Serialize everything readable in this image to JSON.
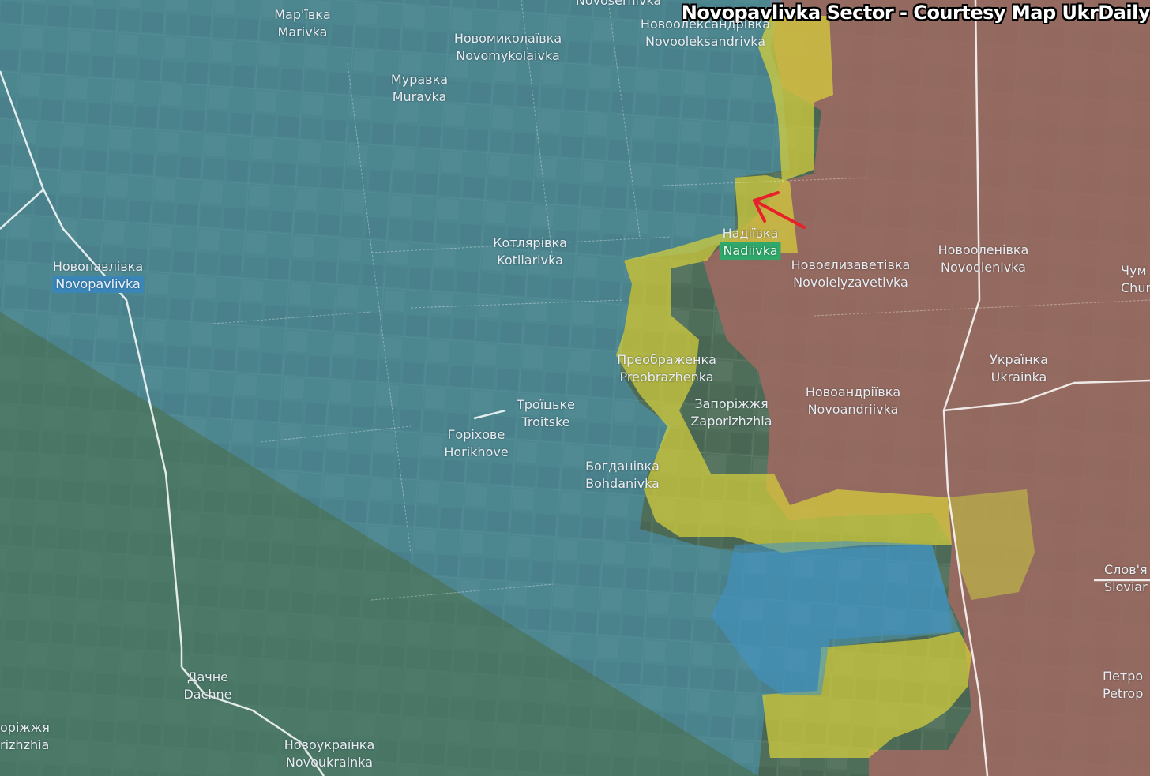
{
  "title": "Novopavlivka Sector - Courtesy Map UkrDaily",
  "colors": {
    "ukraine_control": "#4aa6d9",
    "contested": "#d8d13a",
    "russia_control": "#c97474",
    "roads": "#ffffff",
    "arrow": "#e8202a"
  },
  "places": [
    {
      "uk": "",
      "lat": "Novosernivka"
    },
    {
      "uk": "Новоолександрівка",
      "lat": "Novooleksandrivka"
    },
    {
      "uk": "Мар'ївка",
      "lat": "Marivka"
    },
    {
      "uk": "Новомиколаївка",
      "lat": "Novomykolaivka"
    },
    {
      "uk": "Муравка",
      "lat": "Muravka"
    },
    {
      "uk": "Новопавлівка",
      "lat": "Novopavlivka"
    },
    {
      "uk": "Котлярівка",
      "lat": "Kotliarivka"
    },
    {
      "uk": "Надіївка",
      "lat": "Nadiivka"
    },
    {
      "uk": "Новоєлизаветівка",
      "lat": "Novoielyzavetivka"
    },
    {
      "uk": "Новооленівка",
      "lat": "Novoolenivka"
    },
    {
      "uk": "Чум",
      "lat": "Chun"
    },
    {
      "uk": "Преображенка",
      "lat": "Preobrazhenka"
    },
    {
      "uk": "Українка",
      "lat": "Ukrainka"
    },
    {
      "uk": "Троїцьке",
      "lat": "Troitske"
    },
    {
      "uk": "Запоріжжя",
      "lat": "Zaporizhzhia"
    },
    {
      "uk": "Новоандріївка",
      "lat": "Novoandriivka"
    },
    {
      "uk": "Горіхове",
      "lat": "Horikhove"
    },
    {
      "uk": "Богданівка",
      "lat": "Bohdanivka"
    },
    {
      "uk": "Слов'я",
      "lat": "Sloviar"
    },
    {
      "uk": "Дачне",
      "lat": "Dachne"
    },
    {
      "uk": "Петро",
      "lat": "Petrop"
    },
    {
      "uk": "оріжжя",
      "lat": "rizhzhia"
    },
    {
      "uk": "Новоукраїнка",
      "lat": "Novoukrainka"
    }
  ]
}
